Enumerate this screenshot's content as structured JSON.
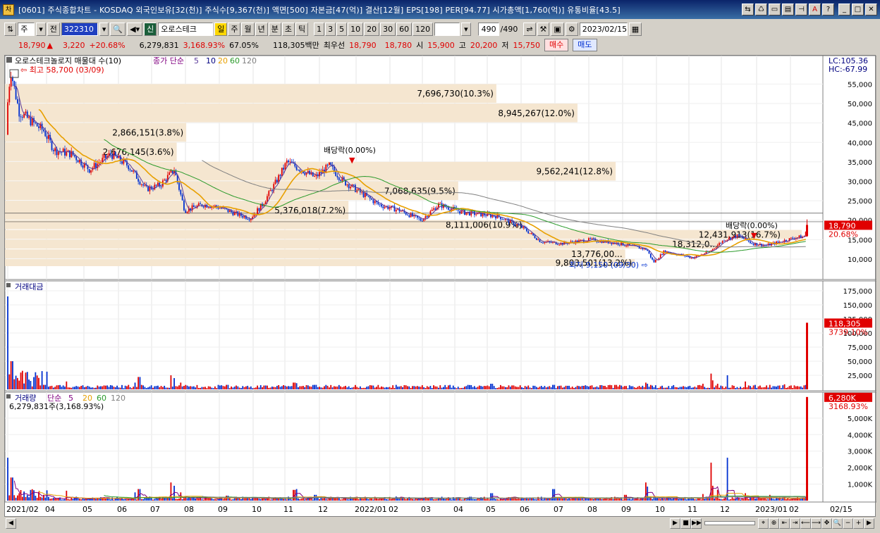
{
  "window": {
    "title": "[0601] 주식종합차트 - KOSDAQ 외국인보유[32(천)] 주식수[9,367(천)] 액면[500] 자본금[47(억)] 결산[12월] EPS[198] PER[94.77] 시가총액[1,760(억)] 유통비율[43.5]",
    "icon_text": "차"
  },
  "toolbar": {
    "mode": "주",
    "prev_label": "전",
    "code": "322310",
    "stock_badge": "신",
    "stock_name": "오로스테크",
    "periods": [
      "일",
      "주",
      "월",
      "년",
      "분",
      "초",
      "틱"
    ],
    "active_period": "일",
    "intervals": [
      "1",
      "3",
      "5",
      "10",
      "20",
      "30",
      "60",
      "120"
    ],
    "count": "490",
    "count_total": "/490",
    "date": "2023/02/15"
  },
  "quote": {
    "price": "18,790",
    "arrow": "▲",
    "change": "3,220",
    "change_pct": "+20.68%",
    "volume": "6,279,831",
    "volume_ratio": "3,168.93%",
    "turnover_pct": "67.05%",
    "amount": "118,305백만",
    "best_ask_label": "최우선",
    "ask": "18,790",
    "bid": "18,780",
    "open_label": "시",
    "open": "15,900",
    "high_label": "고",
    "high": "20,200",
    "low_label": "저",
    "low": "15,750",
    "buy_label": "매수",
    "sell_label": "매도"
  },
  "price_panel": {
    "legend_name": "오로스테크놀로지 매물대 수(10)",
    "legend_ma": "종가 단순",
    "ma_periods": [
      "5",
      "10",
      "20",
      "60",
      "120"
    ],
    "lc_label": "LC:105.36",
    "hc_label": "HC:-67.99",
    "high_marker": "최고 58,700 (03/09)",
    "low_marker": "최저 9,150 (09/30)",
    "dividend_marks": [
      "배당락(0.00%)",
      "배당락(0.00%)"
    ],
    "current_price_tag": "18,790",
    "current_pct_tag": "20.68%",
    "y_ticks": [
      "55,000",
      "50,000",
      "45,000",
      "40,000",
      "35,000",
      "30,000",
      "25,000",
      "20,000",
      "15,000",
      "10,000"
    ],
    "volume_profile": [
      {
        "label": "7,696,730(10.3%)"
      },
      {
        "label": "8,945,267(12.0%)"
      },
      {
        "label": "2,866,151(3.8%)"
      },
      {
        "label": "2,676,145(3.6%)"
      },
      {
        "label": "9,562,241(12.8%)"
      },
      {
        "label": "7,068,635(9.5%)"
      },
      {
        "label": "5,376,018(7.2%)"
      },
      {
        "label": "8,111,006(10.9%)"
      },
      {
        "label": "12,431,913(16.7%)"
      },
      {
        "label": "18,312,0..."
      },
      {
        "label": "13,776,00..."
      },
      {
        "label": "9,803,501(13.2%)"
      }
    ]
  },
  "amount_panel": {
    "legend": "거래대금",
    "y_ticks": [
      "175,000",
      "150,000",
      "125,000",
      "100,000",
      "75,000",
      "50,000",
      "25,000"
    ],
    "current_tag": "118,305",
    "current_pct": "3739.10%"
  },
  "volume_panel": {
    "legend": "거래량",
    "legend_ma": "단순",
    "ma_periods": [
      "5",
      "20",
      "60",
      "120"
    ],
    "value_text": "6,279,831주(3,168.93%)",
    "y_ticks": [
      "5,000K",
      "4,000K",
      "3,000K",
      "2,000K",
      "1,000K"
    ],
    "current_tag": "6,280K",
    "current_pct": "3168.93%"
  },
  "x_axis": {
    "labels": [
      "2021/02",
      "04",
      "05",
      "06",
      "07",
      "08",
      "09",
      "10",
      "11",
      "12",
      "2022/01",
      "02",
      "03",
      "04",
      "05",
      "06",
      "07",
      "08",
      "09",
      "10",
      "11",
      "12",
      "2023/01",
      "02"
    ],
    "right_label": "02/15"
  },
  "colors": {
    "up": "#e00000",
    "down": "#0030d0",
    "profile": "#f5e6d0",
    "ma5": "#5a3a9a",
    "ma20": "#e8a000",
    "ma60": "#2a9a2a",
    "ma120": "#808080"
  }
}
